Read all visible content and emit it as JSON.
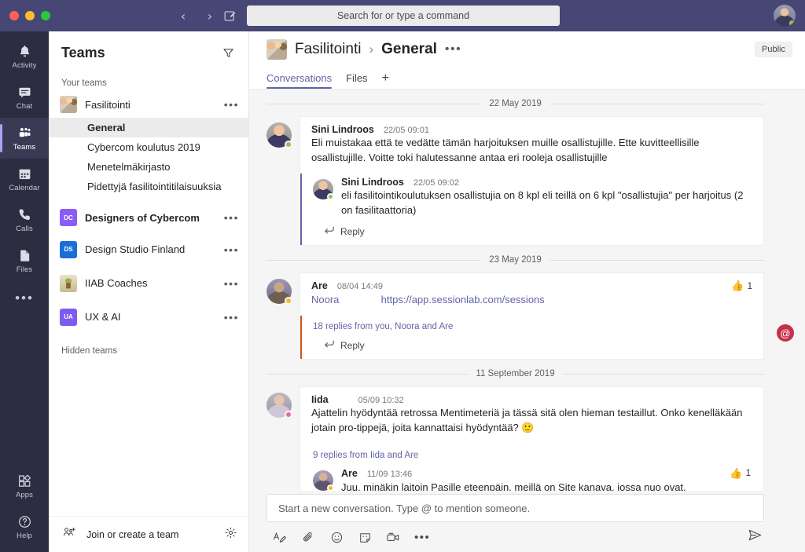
{
  "titlebar": {
    "back_icon": "chevron-left-icon",
    "forward_icon": "chevron-right-icon",
    "compose_icon": "new-chat-icon",
    "search_placeholder": "Search for or type a command",
    "avatar_name": "user-avatar"
  },
  "rail": {
    "items": [
      {
        "label": "Activity",
        "icon": "bell-icon",
        "active": false
      },
      {
        "label": "Chat",
        "icon": "chat-icon",
        "active": false
      },
      {
        "label": "Teams",
        "icon": "teams-icon",
        "active": true
      },
      {
        "label": "Calendar",
        "icon": "calendar-icon",
        "active": false
      },
      {
        "label": "Calls",
        "icon": "phone-icon",
        "active": false
      },
      {
        "label": "Files",
        "icon": "file-icon",
        "active": false
      }
    ],
    "more_label": "•••",
    "bottom": [
      {
        "label": "Apps",
        "icon": "apps-icon"
      },
      {
        "label": "Help",
        "icon": "help-icon"
      }
    ]
  },
  "teams_panel": {
    "title": "Teams",
    "filter_icon": "filter-icon",
    "your_teams_label": "Your teams",
    "hidden_teams_label": "Hidden teams",
    "more_glyph": "•••",
    "teams": [
      {
        "name": "Fasilitointi",
        "avatar_kind": "photo",
        "avatar_text": "",
        "bold": false
      },
      {
        "name": "Designers of Cybercom",
        "avatar_kind": "initials",
        "avatar_text": "DC",
        "avatar_color": "#8b5cf6",
        "bold": true
      },
      {
        "name": "Design Studio Finland",
        "avatar_kind": "initials",
        "avatar_text": "DS",
        "avatar_color": "#1a6ed8",
        "bold": false
      },
      {
        "name": "IIAB Coaches",
        "avatar_kind": "photo2",
        "avatar_text": "",
        "bold": false
      },
      {
        "name": "UX & AI",
        "avatar_kind": "initials",
        "avatar_text": "UA",
        "avatar_color": "#7e5bef",
        "bold": false
      }
    ],
    "channels": [
      {
        "name": "General",
        "active": true
      },
      {
        "name": "Cybercom koulutus 2019",
        "active": false
      },
      {
        "name": "Menetelmäkirjasto",
        "active": false
      },
      {
        "name": "Pidettyjä fasilitointitilaisuuksia",
        "active": false
      }
    ],
    "footer": {
      "join_label": "Join or create a team",
      "join_icon": "add-team-icon",
      "settings_icon": "gear-icon"
    }
  },
  "channel_header": {
    "team": "Fasilitointi",
    "separator": "›",
    "channel": "General",
    "more_glyph": "•••",
    "badge": "Public",
    "team_avatar": "team-photo-avatar"
  },
  "tabs": [
    {
      "label": "Conversations",
      "active": true
    },
    {
      "label": "Files",
      "active": false
    }
  ],
  "tab_add_glyph": "+",
  "conversation": {
    "groups": [
      {
        "date": "22 May 2019",
        "avatar_class": "av-a",
        "presence": "available",
        "root": {
          "author": "Sini Lindroos",
          "time": "22/05 09:01",
          "text": "Eli muistakaa että te vedätte tämän harjoituksen muille osallistujille. Ette kuvitteellisille osallistujille. Voitte toki halutessanne antaa eri rooleja osallistujille"
        },
        "accent": "purple",
        "replies": [
          {
            "author": "Sini Lindroos",
            "time": "22/05 09:02",
            "text": "eli fasilitointikoulutuksen osallistujia on 8 kpl eli teillä on 6 kpl \"osallistujia\" per harjoitus (2 on fasilitaattoria)",
            "avatar_class": "av-a",
            "presence": "available"
          }
        ],
        "reply_label": "Reply",
        "reply_icon": "reply-arrow-icon"
      },
      {
        "date": "23 May 2019",
        "avatar_class": "av-b",
        "presence": "away",
        "root": {
          "author": "Are",
          "time": "08/04 14:49",
          "text_prefix": "Noora",
          "link_text": "https://app.sessionlab.com/sessions",
          "reaction_icon": "thumbs-up-icon",
          "reaction_count": "1"
        },
        "accent": "orange",
        "replies_summary": "18 replies from you, Noora and Are",
        "reply_label": "Reply",
        "reply_icon": "reply-arrow-icon",
        "mention_badge": "@"
      },
      {
        "date": "11 September 2019",
        "avatar_class": "av-c",
        "presence": "busy",
        "root": {
          "author": "Iida",
          "time": "05/09 10:32",
          "text": "Ajattelin hyödyntää retrossa Mentimeteriä ja tässä sitä olen hieman testaillut. Onko kenelläkään jotain pro-tippejä, joita kannattaisi hyödyntää? ",
          "emoji": "🙂"
        },
        "replies_summary": "9 replies from Iida and Are",
        "replies": [
          {
            "author": "Are",
            "time": "11/09 13:46",
            "text": "Juu, minäkin laitoin Pasille eteenpäin, meillä on Site kanava, jossa nuo ovat.",
            "avatar_class": "av-d",
            "presence": "away",
            "reaction_icon": "thumbs-up-icon",
            "reaction_count": "1"
          }
        ]
      }
    ]
  },
  "composer": {
    "placeholder": "Start a new conversation. Type @ to mention someone.",
    "tools": [
      {
        "name": "format-icon"
      },
      {
        "name": "attach-icon"
      },
      {
        "name": "emoji-icon"
      },
      {
        "name": "sticker-icon"
      },
      {
        "name": "meet-now-icon"
      }
    ],
    "more_glyph": "•••",
    "send_icon": "send-icon"
  },
  "colors": {
    "accent": "#6264a7",
    "titlebar": "#464775",
    "rail": "#2d2c40",
    "mention": "#c4314b",
    "presence_available": "#92c353"
  }
}
